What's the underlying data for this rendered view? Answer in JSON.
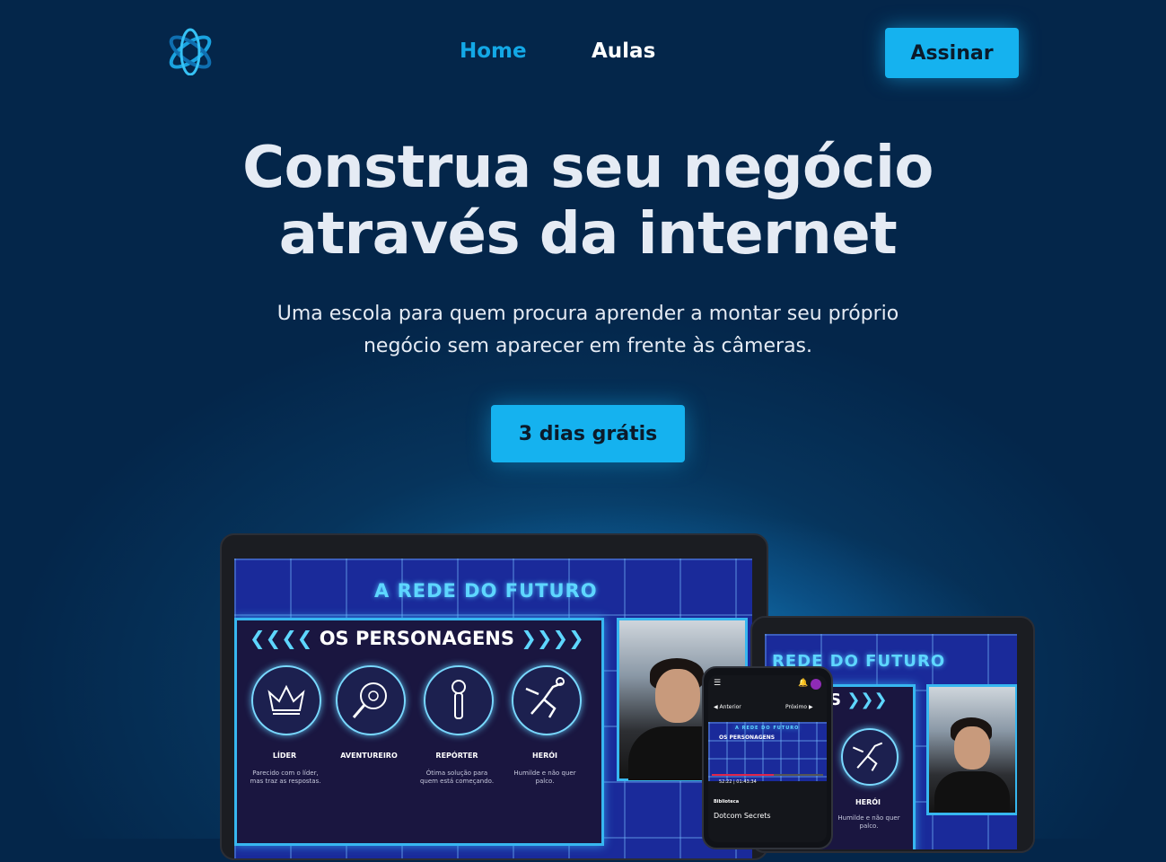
{
  "nav": {
    "logo_icon": "orbit-logo-icon",
    "links": [
      "Home",
      "Aulas"
    ],
    "active": "Home",
    "cta": "Assinar"
  },
  "hero": {
    "title_line1": "Construa seu negócio",
    "title_line2": "através da internet",
    "subtitle_line1": "Uma escola para quem procura aprender a montar seu próprio",
    "subtitle_line2": "negócio sem aparecer em frente às câmeras.",
    "cta": "3 dias grátis"
  },
  "mockup": {
    "screen_title": "A REDE DO FUTURO",
    "screen_title_tablet": "REDE DO FUTURO",
    "panel_title": "OS PERSONAGENS",
    "panel_title_tablet": "NS",
    "characters": [
      {
        "label": "LÍDER",
        "desc_line1": "Parecido com o líder,",
        "desc_line2": "mas traz as respostas.",
        "icon": "crown-icon"
      },
      {
        "label": "AVENTUREIRO",
        "desc_line1": "",
        "desc_line2": "",
        "icon": "magnifier-bug-icon"
      },
      {
        "label": "REPÓRTER",
        "desc_line1": "Ótima solução para",
        "desc_line2": "quem está começando.",
        "icon": "microphone-icon"
      },
      {
        "label": "HERÓI",
        "desc_line1": "Humilde e não quer",
        "desc_line2": "palco.",
        "icon": "superhero-icon"
      }
    ],
    "phone": {
      "prev": "Anterior",
      "next": "Próximo",
      "time_current": "52:22",
      "time_total": "01:43:34",
      "section": "Biblioteca",
      "course": "Dotcom Secrets"
    }
  },
  "colors": {
    "accent": "#15b2ef",
    "background": "#04264a",
    "active_link": "#13a8e6"
  }
}
